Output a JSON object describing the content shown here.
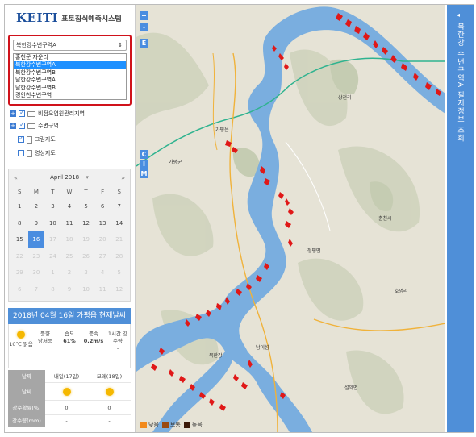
{
  "app": {
    "logo_text": "KEITI",
    "title": "표토침식예측시스템"
  },
  "selector": {
    "current": "북한강수변구역A",
    "options": [
      "홍천군 자운리",
      "북한강수변구역A",
      "북한강수변구역B",
      "남한강수변구역A",
      "남한강수변구역B",
      "경안천수변구역"
    ],
    "selected_index": 1
  },
  "tree": [
    {
      "label": "비점오염원관리지역",
      "expander": "+",
      "checked": true,
      "type": "folder"
    },
    {
      "label": "수변구역",
      "expander": "+",
      "checked": true,
      "type": "folder"
    },
    {
      "label": "그림지도",
      "expander": "",
      "checked": true,
      "type": "doc"
    },
    {
      "label": "영상지도",
      "expander": "",
      "checked": false,
      "type": "doc"
    }
  ],
  "calendar": {
    "month_label": "April 2018",
    "prev": "«",
    "next": "»",
    "dropdown": "▾",
    "weekdays": [
      "S",
      "M",
      "T",
      "W",
      "T",
      "F",
      "S"
    ],
    "days": [
      [
        "1",
        "2",
        "3",
        "4",
        "5",
        "6",
        "7"
      ],
      [
        "8",
        "9",
        "10",
        "11",
        "12",
        "13",
        "14"
      ],
      [
        "15",
        "16",
        "17",
        "18",
        "19",
        "20",
        "21"
      ],
      [
        "22",
        "23",
        "24",
        "25",
        "26",
        "27",
        "28"
      ],
      [
        "29",
        "30",
        "1",
        "2",
        "3",
        "4",
        "5"
      ],
      [
        "6",
        "7",
        "8",
        "9",
        "10",
        "11",
        "12"
      ]
    ],
    "selected_day": "16"
  },
  "weather": {
    "title": "2018년 04월 16일 가평읍 현재날씨",
    "now": [
      {
        "label": "",
        "value": "10℃ 맑음",
        "icon": "sun-icon"
      },
      {
        "label": "풍향",
        "value": "남서풍"
      },
      {
        "label": "습도",
        "value": "61%"
      },
      {
        "label": "풍속",
        "value": "0.2m/s"
      },
      {
        "label": "1시간 강수량",
        "value": "-"
      }
    ],
    "forecast": {
      "headers": [
        "날짜",
        "내일(17일)",
        "모레(18일)"
      ],
      "rows": [
        {
          "label": "날씨",
          "values": [
            "sun-icon",
            "sun-icon"
          ]
        },
        {
          "label": "강수확률(%)",
          "values": [
            "0",
            "0"
          ]
        },
        {
          "label": "강수량(mm)",
          "values": [
            "-",
            "-"
          ]
        }
      ]
    }
  },
  "map": {
    "controls": [
      "+",
      "-",
      "E",
      "C",
      "I",
      "M"
    ],
    "labels": [
      "가평읍",
      "청평면",
      "춘천시",
      "설악면",
      "가평군",
      "북한강",
      "남이섬",
      "상천리",
      "호명리"
    ],
    "legend": [
      {
        "label": "낮음",
        "color": "#f28a1c"
      },
      {
        "label": "보통",
        "color": "#9a4a12"
      },
      {
        "label": "높음",
        "color": "#3b1a08"
      }
    ],
    "erosion_color": "#e01818"
  },
  "right_panel": {
    "title": "북한강 수변구역A 필지정보 조회",
    "toggle": "◂"
  }
}
